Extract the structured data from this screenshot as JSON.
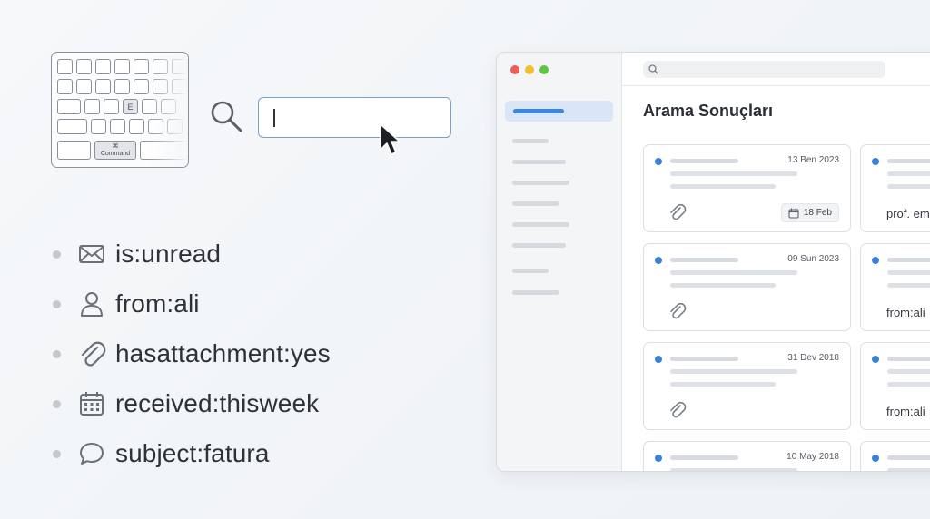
{
  "keyboard": {
    "e_key": "E",
    "command_symbol": "⌘",
    "command_label": "Command"
  },
  "search_illustration": {
    "value": ""
  },
  "operators": [
    {
      "icon": "mail-icon",
      "text": "is:unread"
    },
    {
      "icon": "person-icon",
      "text": "from:ali"
    },
    {
      "icon": "paperclip-icon",
      "text": "hasattachment:yes"
    },
    {
      "icon": "calendar-icon",
      "text": "received:thisweek"
    },
    {
      "icon": "chat-bubble-icon",
      "text": "subject:fatura"
    }
  ],
  "app": {
    "traffic_lights": [
      "#ee5e57",
      "#f4bd2f",
      "#5fc53f"
    ],
    "search_placeholder": "",
    "results_title": "Arama Sonuçları",
    "accent": "#3a80dc",
    "cards_left": [
      {
        "date": "13 Ben 2023",
        "chip": "18 Feb"
      },
      {
        "date": "09 Sun 2023"
      },
      {
        "date": "31 Dev 2018"
      },
      {
        "date": "10 May 2018"
      }
    ],
    "cards_right": [
      {
        "text": "prof. em"
      },
      {
        "text": "from:ali"
      },
      {
        "text": "from:ali"
      },
      {
        "text": ""
      }
    ]
  }
}
